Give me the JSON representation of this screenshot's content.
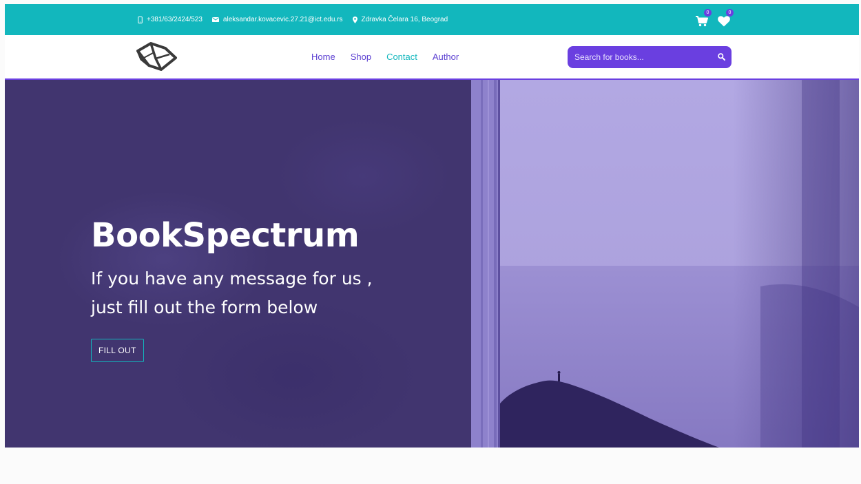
{
  "topbar": {
    "phone": "+381/63/2424/523",
    "email": "aleksandar.kovacevic.27.21@ict.edu.rs",
    "address": "Zdravka Čelara 16, Beograd",
    "cart_count": "0",
    "wishlist_count": "0"
  },
  "nav": {
    "links": [
      "Home",
      "Shop",
      "Contact",
      "Author"
    ],
    "active": "Contact"
  },
  "search": {
    "placeholder": "Search for books..."
  },
  "hero": {
    "title": "BookSpectrum",
    "subtitle_line1": "If you have any message for us ,",
    "subtitle_line2": "just fill out the form below",
    "button": "FILL OUT"
  },
  "colors": {
    "teal": "#12b7bd",
    "purple": "#6a3fe0",
    "hero_bg": "#41356f",
    "lavender": "#aaa0dc"
  },
  "icons": [
    "phone-icon",
    "mail-icon",
    "location-icon",
    "cart-icon",
    "heart-icon",
    "book-logo-icon",
    "search-icon"
  ]
}
